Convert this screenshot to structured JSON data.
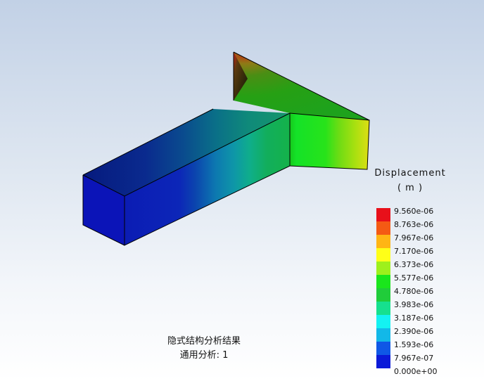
{
  "legend": {
    "title": "Displacement",
    "unit": "( m )",
    "labels": [
      "9.560e-06",
      "8.763e-06",
      "7.967e-06",
      "7.170e-06",
      "6.373e-06",
      "5.577e-06",
      "4.780e-06",
      "3.983e-06",
      "3.187e-06",
      "2.390e-06",
      "1.593e-06",
      "7.967e-07",
      "0.000e+00"
    ],
    "colors": [
      "#e8101a",
      "#f45a14",
      "#ffb514",
      "#ffff18",
      "#9ef01c",
      "#1ae61c",
      "#20cc3a",
      "#16e08e",
      "#14f2f2",
      "#12b8e8",
      "#0f58e6",
      "#0a1ad8"
    ]
  },
  "caption": {
    "line1": "隐式结构分析结果",
    "line2": "通用分析: 1"
  }
}
